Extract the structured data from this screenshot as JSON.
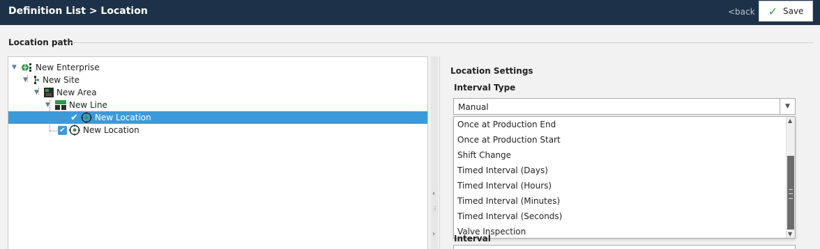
{
  "header": {
    "title": "Definition List > Location",
    "back_label": "<back",
    "save_label": "Save"
  },
  "location_path": {
    "title": "Location path"
  },
  "tree": {
    "enterprise": "New Enterprise",
    "site": "New Site",
    "area": "New Area",
    "line": "New Line",
    "location_selected": "New Location",
    "location_second": "New Location"
  },
  "settings": {
    "title": "Location Settings",
    "interval_type_label": "Interval Type",
    "interval_type_value": "Manual",
    "options": [
      "Once at Production End",
      "Once at Production Start",
      "Shift Change",
      "Timed Interval (Days)",
      "Timed Interval (Hours)",
      "Timed Interval (Minutes)",
      "Timed Interval (Seconds)",
      "Valve Inspection"
    ],
    "interval_label": "Interval"
  },
  "colors": {
    "header_bg": "#1d3248",
    "selection": "#3b9ad9",
    "check_green": "#2a9d3a"
  }
}
